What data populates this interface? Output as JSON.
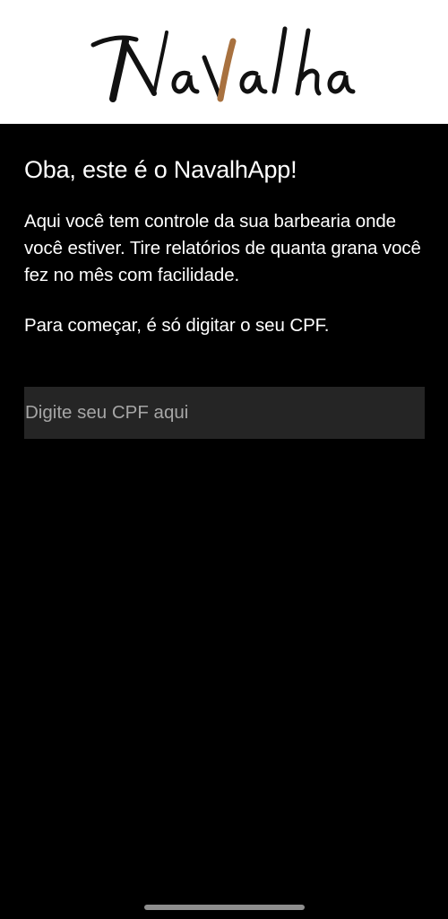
{
  "header": {
    "logo_text": "NaValha",
    "logo_accent_color": "#a8713f"
  },
  "onboarding": {
    "title": "Oba, este é o NavalhApp!",
    "description": "Aqui você tem controle da sua barbearia onde você estiver. Tire relatórios de quanta grana você fez no mês com facilidade.",
    "instruction": "Para começar, é só digitar o seu CPF."
  },
  "cpf_field": {
    "value": "",
    "placeholder": "Digite seu CPF aqui"
  }
}
